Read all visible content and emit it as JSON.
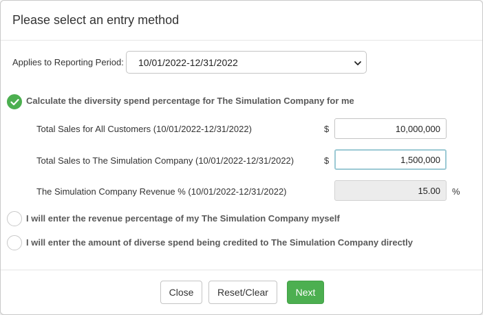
{
  "dialog": {
    "title": "Please select an entry method"
  },
  "period": {
    "label": "Applies to Reporting Period:",
    "selected": "10/01/2022-12/31/2022"
  },
  "options": [
    {
      "label": "Calculate the diversity spend percentage for The Simulation Company for me",
      "checked": true
    },
    {
      "label": "I will enter the revenue percentage of my The Simulation Company myself",
      "checked": false
    },
    {
      "label": "I will enter the amount of diverse spend being credited to The Simulation Company directly",
      "checked": false
    }
  ],
  "fields": {
    "total_sales": {
      "label": "Total Sales for All Customers (10/01/2022-12/31/2022)",
      "prefix": "$",
      "value": "10,000,000"
    },
    "sales_to_company": {
      "label": "Total Sales to The Simulation Company (10/01/2022-12/31/2022)",
      "prefix": "$",
      "value": "1,500,000"
    },
    "revenue_pct": {
      "label": "The Simulation Company Revenue % (10/01/2022-12/31/2022)",
      "value": "15.00",
      "suffix": "%"
    }
  },
  "buttons": {
    "close": "Close",
    "reset": "Reset/Clear",
    "next": "Next"
  },
  "colors": {
    "accent": "#4caf50",
    "focus_border": "#9bc9d4"
  }
}
